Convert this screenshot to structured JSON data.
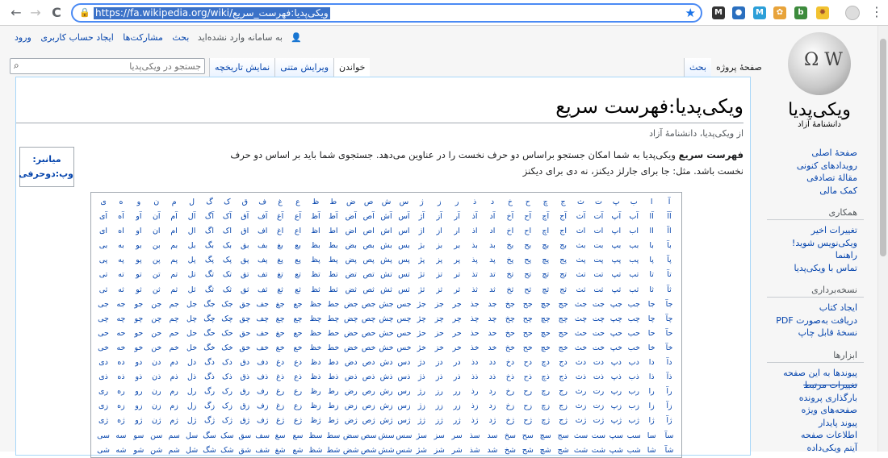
{
  "browser": {
    "url": "https://fa.wikipedia.org/wiki/ویکی‌پدیا:فهرست_سریع",
    "back": "←",
    "forward": "→",
    "reload": "C",
    "menu": "⋮"
  },
  "personal_tools": {
    "not_logged_in": "به سامانه وارد نشده‌اید",
    "talk": "بحث",
    "contributions": "مشارکت‌ها",
    "create_account": "ایجاد حساب کاربری",
    "login": "ورود"
  },
  "logo": {
    "wordmark": "ویکی‌پدیا",
    "tagline": "دانشنامهٔ آزاد"
  },
  "tabs": {
    "project_page": "صفحهٔ پروژه",
    "talk": "بحث",
    "read": "خواندن",
    "edit_source": "ویرایش متنی",
    "history": "نمایش تاریخچه"
  },
  "search": {
    "placeholder": "جستجو در ویکی‌پدیا"
  },
  "article": {
    "title": "ویکی‌پدیا:فهرست سریع",
    "subtitle": "از ویکی‌پدیا، دانشنامهٔ آزاد",
    "intro_bold": "فهرست سریع",
    "intro_text": " ویکی‌پدیا به شما امکان جستجو براساس دو حرف نخست را در عناوین می‌دهد. جستجوی شما باید بر اساس دو حرف نخست باشد. مثل: جا برای جارلز دیکنز، نه دی برای دیکنز"
  },
  "shortcut_box": {
    "label": "میانبر:",
    "value": "وپ:دوحرفی"
  },
  "letter_grid": {
    "rows": [
      [
        "آ",
        "ا",
        "ب",
        "پ",
        "ت",
        "ث",
        "ج",
        "چ",
        "ح",
        "خ",
        "د",
        "ذ",
        "ر",
        "ز",
        "ژ",
        "س",
        "ش",
        "ص",
        "ض",
        "ط",
        "ظ",
        "ع",
        "غ",
        "ف",
        "ق",
        "ک",
        "گ",
        "ل",
        "م",
        "ن",
        "و",
        "ه",
        "ی"
      ],
      [
        "آآ",
        "آا",
        "آب",
        "آپ",
        "آت",
        "آث",
        "آج",
        "آچ",
        "آح",
        "آخ",
        "آد",
        "آذ",
        "آر",
        "آز",
        "آژ",
        "آس",
        "آش",
        "آص",
        "آض",
        "آط",
        "آظ",
        "آع",
        "آغ",
        "آف",
        "آق",
        "آک",
        "آگ",
        "آل",
        "آم",
        "آن",
        "آو",
        "آه",
        "آی"
      ],
      [
        "اآ",
        "اا",
        "اب",
        "اپ",
        "ات",
        "اث",
        "اج",
        "اچ",
        "اح",
        "اخ",
        "اد",
        "اذ",
        "ار",
        "از",
        "اژ",
        "اس",
        "اش",
        "اص",
        "اض",
        "اط",
        "اظ",
        "اع",
        "اغ",
        "اف",
        "اق",
        "اک",
        "اگ",
        "ال",
        "ام",
        "ان",
        "او",
        "اه",
        "ای"
      ],
      [
        "بآ",
        "با",
        "بب",
        "بپ",
        "بت",
        "بث",
        "بج",
        "بچ",
        "بح",
        "بخ",
        "بد",
        "بذ",
        "بر",
        "بز",
        "بژ",
        "بس",
        "بش",
        "بص",
        "بض",
        "بط",
        "بظ",
        "بع",
        "بغ",
        "بف",
        "بق",
        "بک",
        "بگ",
        "بل",
        "بم",
        "بن",
        "بو",
        "به",
        "بی"
      ],
      [
        "پآ",
        "پا",
        "پب",
        "پپ",
        "پت",
        "پث",
        "پج",
        "پچ",
        "پح",
        "پخ",
        "پد",
        "پذ",
        "پر",
        "پز",
        "پژ",
        "پس",
        "پش",
        "پص",
        "پض",
        "پط",
        "پظ",
        "پع",
        "پغ",
        "پف",
        "پق",
        "پک",
        "پگ",
        "پل",
        "پم",
        "پن",
        "پو",
        "په",
        "پی"
      ],
      [
        "تآ",
        "تا",
        "تب",
        "تپ",
        "تت",
        "تث",
        "تج",
        "تچ",
        "تح",
        "تخ",
        "تد",
        "تذ",
        "تر",
        "تز",
        "تژ",
        "تس",
        "تش",
        "تص",
        "تض",
        "تط",
        "تظ",
        "تع",
        "تغ",
        "تف",
        "تق",
        "تک",
        "تگ",
        "تل",
        "تم",
        "تن",
        "تو",
        "ته",
        "تی"
      ],
      [
        "ثآ",
        "ثا",
        "ثب",
        "ثپ",
        "ثت",
        "ثث",
        "ثج",
        "ثچ",
        "ثح",
        "ثخ",
        "ثد",
        "ثذ",
        "ثر",
        "ثز",
        "ثژ",
        "ثس",
        "ثش",
        "ثص",
        "ثض",
        "ثط",
        "ثظ",
        "ثع",
        "ثغ",
        "ثف",
        "ثق",
        "ثک",
        "ثگ",
        "ثل",
        "ثم",
        "ثن",
        "ثو",
        "ثه",
        "ثی"
      ],
      [
        "جآ",
        "جا",
        "جب",
        "جپ",
        "جت",
        "جث",
        "جج",
        "جچ",
        "جح",
        "جخ",
        "جد",
        "جذ",
        "جر",
        "جز",
        "جژ",
        "جس",
        "جش",
        "جص",
        "جض",
        "جط",
        "جظ",
        "جع",
        "جغ",
        "جف",
        "جق",
        "جک",
        "جگ",
        "جل",
        "جم",
        "جن",
        "جو",
        "جه",
        "جی"
      ],
      [
        "چآ",
        "چا",
        "چب",
        "چپ",
        "چت",
        "چث",
        "چج",
        "چچ",
        "چح",
        "چخ",
        "چد",
        "چذ",
        "چر",
        "چز",
        "چژ",
        "چس",
        "چش",
        "چص",
        "چض",
        "چط",
        "چظ",
        "چع",
        "چغ",
        "چف",
        "چق",
        "چک",
        "چگ",
        "چل",
        "چم",
        "چن",
        "چو",
        "چه",
        "چی"
      ],
      [
        "حآ",
        "حا",
        "حب",
        "حپ",
        "حت",
        "حث",
        "حج",
        "حچ",
        "حح",
        "حخ",
        "حد",
        "حذ",
        "حر",
        "حز",
        "حژ",
        "حس",
        "حش",
        "حص",
        "حض",
        "حط",
        "حظ",
        "حع",
        "حغ",
        "حف",
        "حق",
        "حک",
        "حگ",
        "حل",
        "حم",
        "حن",
        "حو",
        "حه",
        "حی"
      ],
      [
        "خآ",
        "خا",
        "خب",
        "خپ",
        "خت",
        "خث",
        "خج",
        "خچ",
        "خح",
        "خخ",
        "خد",
        "خذ",
        "خر",
        "خز",
        "خژ",
        "خس",
        "خش",
        "خص",
        "خض",
        "خط",
        "خظ",
        "خع",
        "خغ",
        "خف",
        "خق",
        "خک",
        "خگ",
        "خل",
        "خم",
        "خن",
        "خو",
        "خه",
        "خی"
      ],
      [
        "دآ",
        "دا",
        "دب",
        "دپ",
        "دت",
        "دث",
        "دج",
        "دچ",
        "دح",
        "دخ",
        "دد",
        "دذ",
        "در",
        "دز",
        "دژ",
        "دس",
        "دش",
        "دص",
        "دض",
        "دط",
        "دظ",
        "دع",
        "دغ",
        "دف",
        "دق",
        "دک",
        "دگ",
        "دل",
        "دم",
        "دن",
        "دو",
        "ده",
        "دی"
      ],
      [
        "ذآ",
        "ذا",
        "ذب",
        "ذپ",
        "ذت",
        "ذث",
        "ذج",
        "ذچ",
        "ذح",
        "ذخ",
        "ذد",
        "ذذ",
        "ذر",
        "ذز",
        "ذژ",
        "ذس",
        "ذش",
        "ذص",
        "ذض",
        "ذط",
        "ذظ",
        "ذع",
        "ذغ",
        "ذف",
        "ذق",
        "ذک",
        "ذگ",
        "ذل",
        "ذم",
        "ذن",
        "ذو",
        "ذه",
        "ذی"
      ],
      [
        "رآ",
        "را",
        "رب",
        "رپ",
        "رت",
        "رث",
        "رج",
        "رچ",
        "رح",
        "رخ",
        "رد",
        "رذ",
        "رر",
        "رز",
        "رژ",
        "رس",
        "رش",
        "رص",
        "رض",
        "رط",
        "رظ",
        "رع",
        "رغ",
        "رف",
        "رق",
        "رک",
        "رگ",
        "رل",
        "رم",
        "رن",
        "رو",
        "ره",
        "ری"
      ],
      [
        "زآ",
        "زا",
        "زب",
        "زپ",
        "زت",
        "زث",
        "زج",
        "زچ",
        "زح",
        "زخ",
        "زد",
        "زذ",
        "زر",
        "زز",
        "زژ",
        "زس",
        "زش",
        "زص",
        "زض",
        "زط",
        "زظ",
        "زع",
        "زغ",
        "زف",
        "زق",
        "زک",
        "زگ",
        "زل",
        "زم",
        "زن",
        "زو",
        "زه",
        "زی"
      ],
      [
        "ژآ",
        "ژا",
        "ژب",
        "ژپ",
        "ژت",
        "ژث",
        "ژج",
        "ژچ",
        "ژح",
        "ژخ",
        "ژد",
        "ژذ",
        "ژر",
        "ژز",
        "ژژ",
        "ژس",
        "ژش",
        "ژص",
        "ژض",
        "ژط",
        "ژظ",
        "ژع",
        "ژغ",
        "ژف",
        "ژق",
        "ژک",
        "ژگ",
        "ژل",
        "ژم",
        "ژن",
        "ژو",
        "ژه",
        "ژی"
      ],
      [
        "سآ",
        "سا",
        "سب",
        "سپ",
        "ست",
        "سث",
        "سج",
        "سچ",
        "سح",
        "سخ",
        "سد",
        "سذ",
        "سر",
        "سز",
        "سژ",
        "سس",
        "سش",
        "سص",
        "سض",
        "سط",
        "سظ",
        "سع",
        "سغ",
        "سف",
        "سق",
        "سک",
        "سگ",
        "سل",
        "سم",
        "سن",
        "سو",
        "سه",
        "سی"
      ],
      [
        "شآ",
        "شا",
        "شب",
        "شپ",
        "شت",
        "شث",
        "شج",
        "شچ",
        "شح",
        "شخ",
        "شد",
        "شذ",
        "شر",
        "شز",
        "شژ",
        "شس",
        "شش",
        "شص",
        "شض",
        "شط",
        "شظ",
        "شع",
        "شغ",
        "شف",
        "شق",
        "شک",
        "شگ",
        "شل",
        "شم",
        "شن",
        "شو",
        "شه",
        "شی"
      ]
    ]
  },
  "sidebar": {
    "main": [
      "صفحهٔ اصلی",
      "رویدادهای کنونی",
      "مقالهٔ تصادفی",
      "کمک مالی"
    ],
    "interaction_head": "همکاری",
    "interaction": [
      "تغییرات اخیر",
      "ویکی‌نویس شوید!",
      "راهنما",
      "تماس با ویکی‌پدیا"
    ],
    "print_head": "نسخه‌برداری",
    "print": [
      "ایجاد کتاب",
      "دریافت به‌صورت PDF",
      "نسخهٔ قابل چاپ"
    ],
    "tools_head": "ابزارها",
    "tools": [
      "پیوندها به این صفحه",
      "تغییرات مرتبط",
      "بارگذاری پرونده",
      "صفحه‌های ویژه",
      "پیوند پایدار",
      "اطلاعات صفحه",
      "آیتم ویکی‌داده"
    ]
  },
  "colors": {
    "link": "#0645ad",
    "accent": "#1a73e8",
    "url_highlight": "#3b72c8"
  }
}
